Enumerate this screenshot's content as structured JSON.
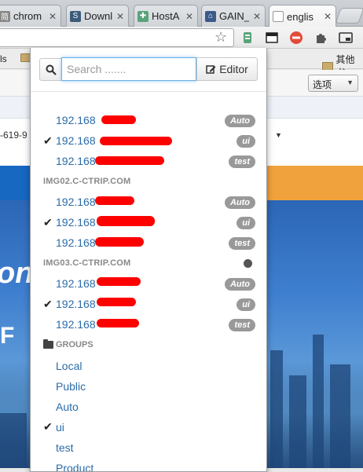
{
  "browser": {
    "tabs": [
      {
        "label": "chrom",
        "favicon": "chinese-char-icon",
        "color": "#555555"
      },
      {
        "label": "Downl",
        "favicon": "s-logo-icon",
        "color": "#3b5b7a"
      },
      {
        "label": "HostA",
        "favicon": "puzzle-icon",
        "color": "#5aa37a"
      },
      {
        "label": "GAIN_",
        "favicon": "house-icon",
        "color": "#3a5a8a"
      },
      {
        "label": "englis",
        "favicon": "document-icon",
        "color": "#ffffff",
        "active": true
      }
    ],
    "tab_close": "✕",
    "toolbar": {
      "star": "☆",
      "extensions": [
        "hostadmin-icon",
        "window-icon",
        "no-entry-icon",
        "puzzle-icon",
        "cast-icon"
      ]
    },
    "bookmarks": {
      "left_text": "ls",
      "right_text": "其他书"
    }
  },
  "page": {
    "select_label": "选项",
    "select_caret": "▼",
    "phone_fragment": "-619-9",
    "triangle": "▼",
    "hero_big": "ong",
    "hero_small": "F"
  },
  "popup": {
    "search": {
      "placeholder": "Search .......",
      "icon": "search-icon"
    },
    "editor_label": "Editor",
    "entries": [
      {
        "type": "host",
        "host": "192.168",
        "checked": false,
        "badge": "Auto"
      },
      {
        "type": "host",
        "host": "192.168",
        "checked": true,
        "badge": "ui"
      },
      {
        "type": "host",
        "host": "192.168",
        "checked": false,
        "badge": "test"
      },
      {
        "type": "group",
        "title": "IMG02.C-CTRIP.COM"
      },
      {
        "type": "host",
        "host": "192.168",
        "checked": false,
        "badge": "Auto"
      },
      {
        "type": "host",
        "host": "192.168",
        "checked": true,
        "badge": "ui"
      },
      {
        "type": "host",
        "host": "192.168",
        "checked": false,
        "badge": "test"
      },
      {
        "type": "group",
        "title": "IMG03.C-CTRIP.COM",
        "globe": true
      },
      {
        "type": "host",
        "host": "192.168",
        "checked": false,
        "badge": "Auto"
      },
      {
        "type": "host",
        "host": "192.168",
        "checked": true,
        "badge": "ui"
      },
      {
        "type": "host",
        "host": "192.168",
        "checked": false,
        "badge": "test"
      }
    ],
    "groups_title": "GROUPS",
    "groups": [
      {
        "name": "Local",
        "checked": false
      },
      {
        "name": "Public",
        "checked": false
      },
      {
        "name": "Auto",
        "checked": false
      },
      {
        "name": "ui",
        "checked": true
      },
      {
        "name": "test",
        "checked": false
      },
      {
        "name": "Product",
        "checked": false
      }
    ],
    "check_glyph": "✔"
  },
  "colors": {
    "link": "#2a6ba8",
    "badge": "#999999",
    "redaction": "#ff0000",
    "focus": "#66afe9"
  }
}
